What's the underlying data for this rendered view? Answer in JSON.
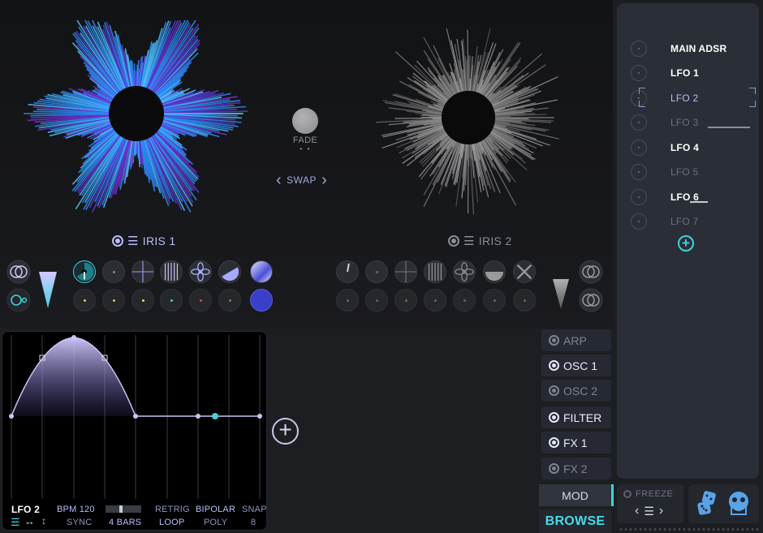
{
  "iris1": {
    "title": "IRIS 1"
  },
  "iris2": {
    "title": "IRIS 2"
  },
  "center": {
    "fade_label": "FADE",
    "swap_label": "SWAP"
  },
  "mod_list": {
    "items": [
      {
        "label": "MAIN ADSR",
        "state": "on"
      },
      {
        "label": "LFO 1",
        "state": "on"
      },
      {
        "label": "LFO 2",
        "state": "selected"
      },
      {
        "label": "LFO 3",
        "state": "off"
      },
      {
        "label": "LFO 4",
        "state": "on"
      },
      {
        "label": "LFO 5",
        "state": "off"
      },
      {
        "label": "LFO 6",
        "state": "on"
      },
      {
        "label": "LFO 7",
        "state": "off"
      }
    ]
  },
  "lfo_editor": {
    "name": "LFO 2",
    "bpm": "BPM 120",
    "sync": "SYNC",
    "length": "4 BARS",
    "retrig": "RETRIG",
    "loop": "LOOP",
    "bipolar": "BIPOLAR",
    "poly": "POLY",
    "snap": "SNAP",
    "snap_value": "8"
  },
  "modules": [
    {
      "label": "ARP",
      "state": "off"
    },
    {
      "label": "OSC 1",
      "state": "on"
    },
    {
      "label": "OSC 2",
      "state": "off"
    },
    {
      "label": "FILTER",
      "state": "on"
    },
    {
      "label": "FX 1",
      "state": "on"
    },
    {
      "label": "FX 2",
      "state": "off"
    }
  ],
  "tabs": {
    "mod": "MOD",
    "browse": "BROWSE"
  },
  "freeze": {
    "label": "FREEZE"
  },
  "colors": {
    "accent_cyan": "#3fd3e0",
    "accent_purple": "#6b5df0",
    "accent_lavender": "#b7befb"
  }
}
